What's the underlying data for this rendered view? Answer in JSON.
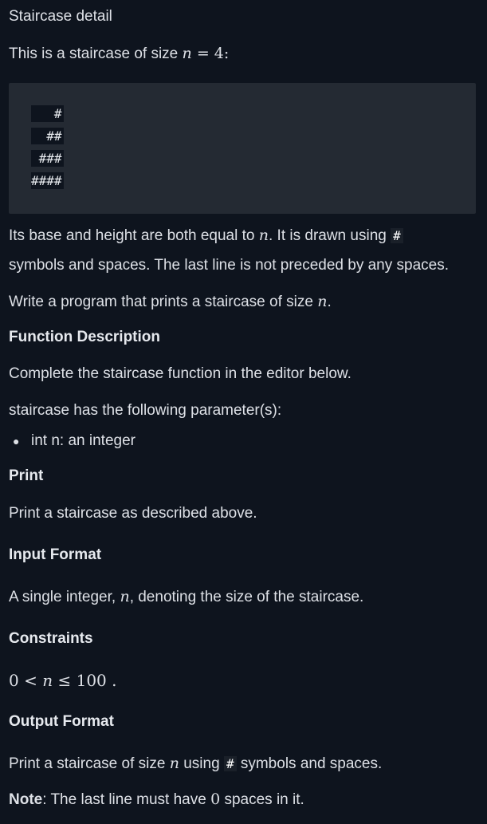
{
  "title": "Staircase detail",
  "intro": {
    "text": "This is a staircase of size ",
    "var": "n",
    "eq": " = 4:"
  },
  "example": {
    "lines": [
      "   #",
      "  ##",
      " ###",
      "####"
    ]
  },
  "desc1": {
    "a": "Its base and height are both equal to ",
    "var": "n",
    "b": ". It is drawn using ",
    "code": "#"
  },
  "desc2": "symbols and spaces. The last line is not preceded by any spaces.",
  "desc3": {
    "a": "Write a program that prints a staircase of size ",
    "var": "n",
    "b": "."
  },
  "function_description": {
    "heading": "Function Description",
    "text": "Complete the staircase function in the editor below.",
    "params_intro": "staircase has the following parameter(s):",
    "params": [
      "int n: an integer"
    ]
  },
  "print": {
    "heading": "Print",
    "text": "Print a staircase as described above."
  },
  "input_format": {
    "heading": "Input Format",
    "a": "A single integer, ",
    "var": "n",
    "b": ", denoting the size of the staircase."
  },
  "constraints": {
    "heading": "Constraints",
    "zero": "0",
    "lt": " < ",
    "var": "n",
    "le": " ≤ ",
    "hundred": "100",
    "end": " ."
  },
  "output_format": {
    "heading": "Output Format",
    "a": "Print a staircase of size ",
    "var": "n",
    "b": " using ",
    "code": "#",
    "c": " symbols and spaces."
  },
  "note": {
    "label": "Note",
    "a": ": The last line must have ",
    "zero": "0",
    "b": " spaces in it."
  }
}
